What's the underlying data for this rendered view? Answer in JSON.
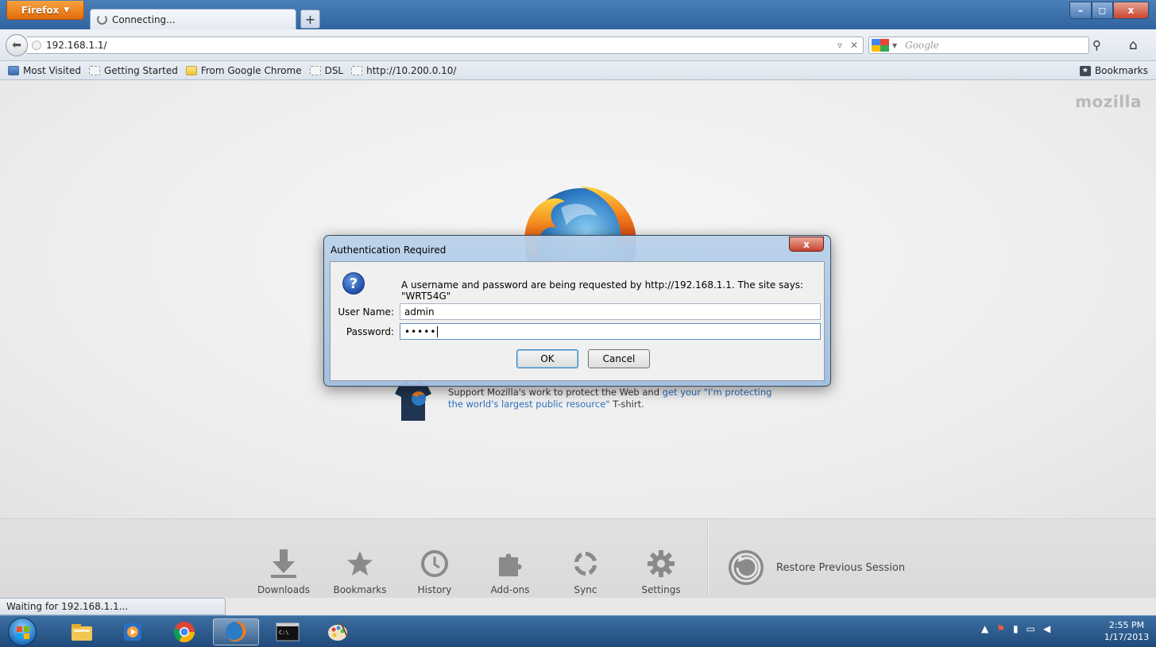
{
  "browser": {
    "menu_label": "Firefox",
    "tab_title": "Connecting...",
    "new_tab_label": "+",
    "window_controls": {
      "minimize": "–",
      "maximize": "◻",
      "close": "x"
    }
  },
  "navigation": {
    "url": "192.168.1.1/",
    "search_placeholder": "Google"
  },
  "bookmarks_bar": {
    "items": [
      {
        "label": "Most Visited",
        "icon": "most-visited-icon"
      },
      {
        "label": "Getting Started",
        "icon": "page-icon"
      },
      {
        "label": "From Google Chrome",
        "icon": "folder-icon"
      },
      {
        "label": "DSL",
        "icon": "page-icon"
      },
      {
        "label": "http://10.200.0.10/",
        "icon": "page-icon"
      }
    ],
    "bookmarks_menu": "Bookmarks"
  },
  "content": {
    "brand": "mozilla",
    "support_text_1": "Support Mozilla's work to protect the Web and ",
    "support_link_1": "get your \"I'm protecting",
    "support_link_2": "the world's largest public resource\"",
    "support_text_2": " T-shirt."
  },
  "launcher": {
    "items": [
      {
        "label": "Downloads",
        "icon": "download-icon"
      },
      {
        "label": "Bookmarks",
        "icon": "star-icon"
      },
      {
        "label": "History",
        "icon": "clock-icon"
      },
      {
        "label": "Add-ons",
        "icon": "puzzle-icon"
      },
      {
        "label": "Sync",
        "icon": "sync-icon"
      },
      {
        "label": "Settings",
        "icon": "gear-icon"
      }
    ],
    "restore_label": "Restore Previous Session"
  },
  "status": {
    "text": "Waiting for 192.168.1.1..."
  },
  "dialog": {
    "title": "Authentication Required",
    "close_label": "x",
    "message": "A username and password are being requested by http://192.168.1.1. The site says: \"WRT54G\"",
    "username_label": "User Name:",
    "username_value": "admin",
    "password_label": "Password:",
    "password_value": "•••••",
    "ok_label": "OK",
    "cancel_label": "Cancel"
  },
  "taskbar": {
    "time": "2:55 PM",
    "date": "1/17/2013"
  }
}
